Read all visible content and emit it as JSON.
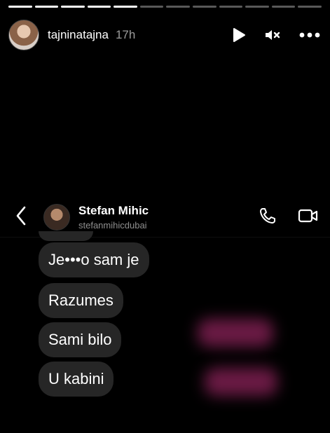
{
  "story": {
    "progress_segments_total": 12,
    "progress_segments_done": 5,
    "username": "tajninatajna",
    "time_ago": "17h",
    "icons": [
      "play-icon",
      "mute-icon",
      "more-icon"
    ]
  },
  "chat": {
    "contact_name": "Stefan Mihic",
    "contact_handle": "stefanmihicdubai",
    "icons": [
      "back-icon",
      "phone-icon",
      "video-icon"
    ],
    "messages": [
      {
        "text": "Je•••o sam je"
      },
      {
        "text": "Razumes"
      },
      {
        "text": "Sami bilo"
      },
      {
        "text": "U kabini"
      }
    ]
  },
  "colors": {
    "background": "#000000",
    "bubble": "#262626",
    "redaction_blur": "#6a1a44"
  }
}
